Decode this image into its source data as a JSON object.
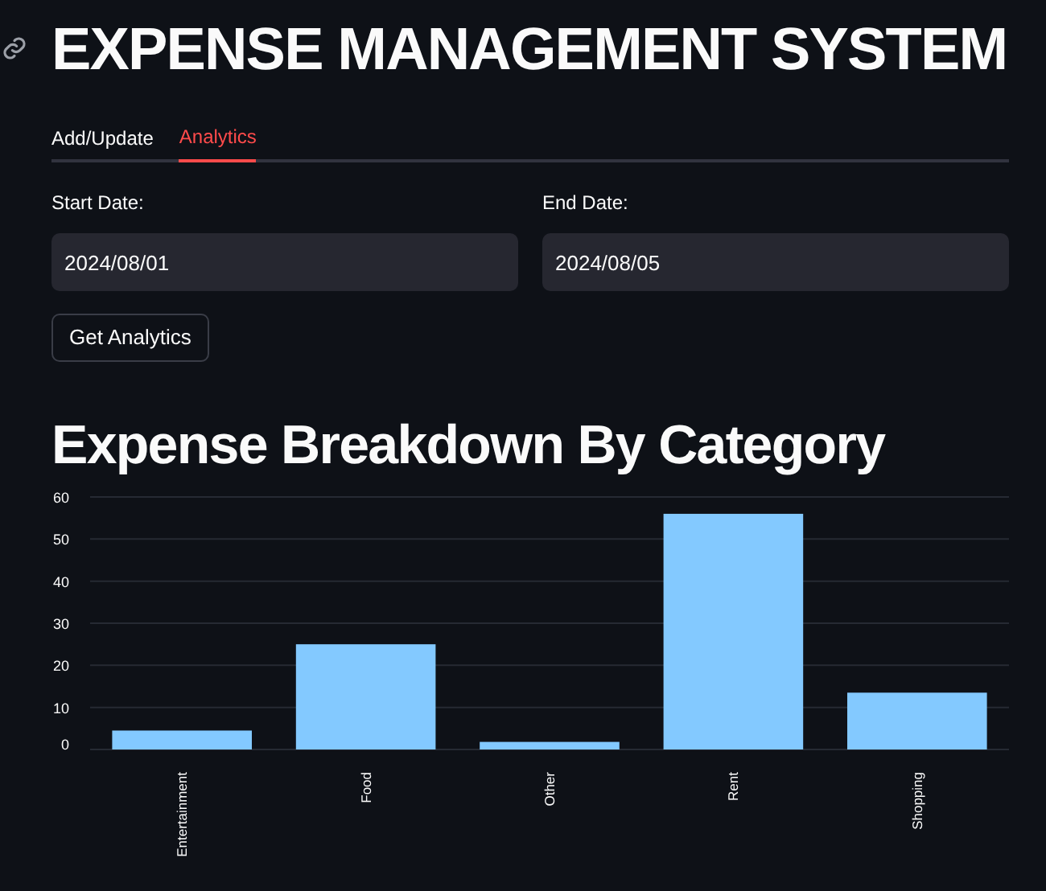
{
  "title": "EXPENSE MANAGEMENT SYSTEM",
  "tabs": [
    {
      "label": "Add/Update",
      "selected": false
    },
    {
      "label": "Analytics",
      "selected": true
    }
  ],
  "date_fields": [
    {
      "label": "Start Date:",
      "value": "2024/08/01"
    },
    {
      "label": "End Date:",
      "value": "2024/08/05"
    }
  ],
  "button": "Get Analytics",
  "heading": "Expense Breakdown By Category",
  "chart_data": {
    "type": "bar",
    "categories": [
      "Entertainment",
      "Food",
      "Other",
      "Rent",
      "Shopping"
    ],
    "series": [
      {
        "color": "#83c9ff",
        "values": [
          4.5,
          25,
          1.8,
          56,
          13.5
        ]
      }
    ],
    "grid": true,
    "ylim": [
      0,
      60
    ],
    "yticks": [
      0,
      10,
      20,
      30,
      40,
      50,
      60
    ]
  }
}
